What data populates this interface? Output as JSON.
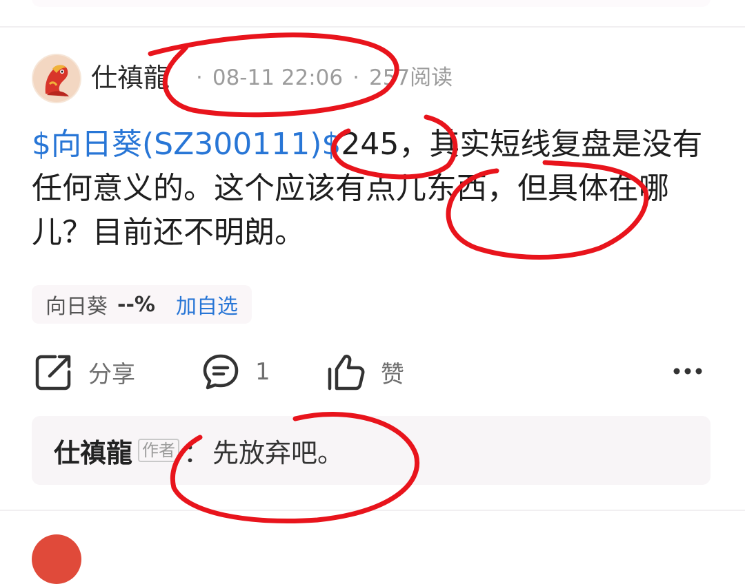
{
  "post": {
    "author": "仕禛龍",
    "date": "08-11 22:06",
    "separator": "·",
    "reads": "257阅读",
    "body_link": "$向日葵(SZ300111)$",
    "body_text": "245，其实短线复盘是没有任何意义的。这个应该有点儿东西，但具体在哪儿？目前还不明朗。"
  },
  "stock_chip": {
    "name": "向日葵",
    "change": "--%",
    "add_label": "加自选"
  },
  "actions": {
    "share_label": "分享",
    "comment_count": "1",
    "like_label": "赞"
  },
  "reply": {
    "author": "仕禛龍",
    "author_tag": "作者",
    "colon": "：",
    "text": "先放弃吧。"
  },
  "icons": [
    "share-icon",
    "comment-icon",
    "thumbs-up-icon",
    "more-icon"
  ],
  "annotation_color": "#e8141c"
}
